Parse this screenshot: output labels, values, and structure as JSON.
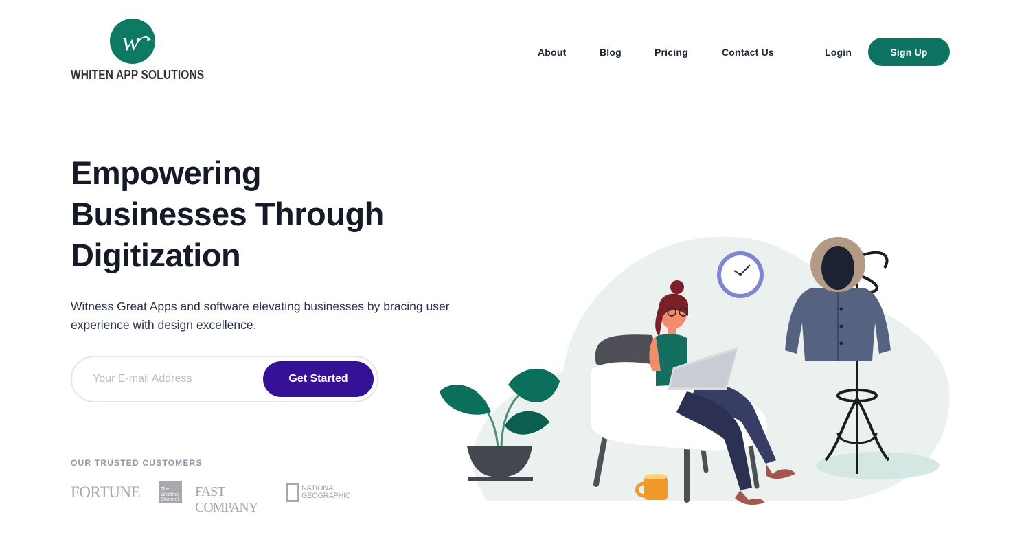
{
  "brand": {
    "logo_letter": "w",
    "name": "WHITEN APP SOLUTIONS",
    "accent": "#0e7a63"
  },
  "nav": {
    "about": "About",
    "blog": "Blog",
    "pricing": "Pricing",
    "contact": "Contact Us",
    "login": "Login",
    "signup": "Sign Up"
  },
  "hero": {
    "title_line1": "Empowering",
    "title_line2": "Businesses Through",
    "title_line3": "Digitization",
    "subtitle": "Witness Great Apps and software elevating businesses by bracing user experience with design excellence."
  },
  "form": {
    "email_placeholder": "Your E-mail Address",
    "email_value": "",
    "cta": "Get Started",
    "cta_color": "#351196"
  },
  "trusted": {
    "label": "OUR TRUSTED CUSTOMERS",
    "logos": {
      "fortune": "FORTUNE",
      "weather": "The Weather Channel",
      "fastco": "FAST COMPANY",
      "natgeo_line1": "NATIONAL",
      "natgeo_line2": "GEOGRAPHIC"
    }
  }
}
